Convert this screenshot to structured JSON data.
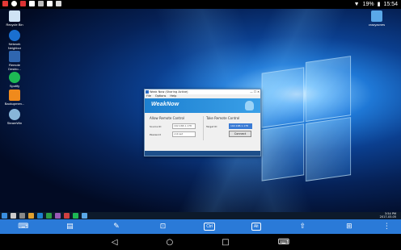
{
  "status_bar": {
    "battery": "19%",
    "time": "15:54"
  },
  "desktop_icons": [
    {
      "label": "Recycle Bin",
      "color": "#cfe3f5"
    },
    {
      "label": "Network Neighbor",
      "color": "#1a6fd0"
    },
    {
      "label": "Remote Deskto...",
      "color": "#2f66b0"
    },
    {
      "label": "Spotify",
      "color": "#1db954"
    },
    {
      "label": "Backupmen...",
      "color": "#f08a1c"
    },
    {
      "label": "SteamWin",
      "color": "#88b6d9"
    }
  ],
  "right_icon": {
    "label": "crazyacnes",
    "color": "#5aa8e8"
  },
  "app": {
    "title": "Weak Now (Sharing Active)",
    "menu": [
      "File",
      "Options",
      "Help"
    ],
    "brand": "WeakNow",
    "allow": {
      "title": "Allow Remote Control",
      "source_label": "Source ID",
      "source_value": "192.168.1.178",
      "password_label": "Password",
      "password_value": "vn1ned"
    },
    "take": {
      "title": "Take Remote Control",
      "target_label": "Target ID",
      "target_value": "192.168.1.178",
      "connect_label": "Connect"
    }
  },
  "taskbar": {
    "clock_time": "3:54 PM",
    "clock_date": "2017-03-05"
  },
  "toolbar": {
    "ctrl": "Ctrl",
    "alt": "Alt"
  }
}
